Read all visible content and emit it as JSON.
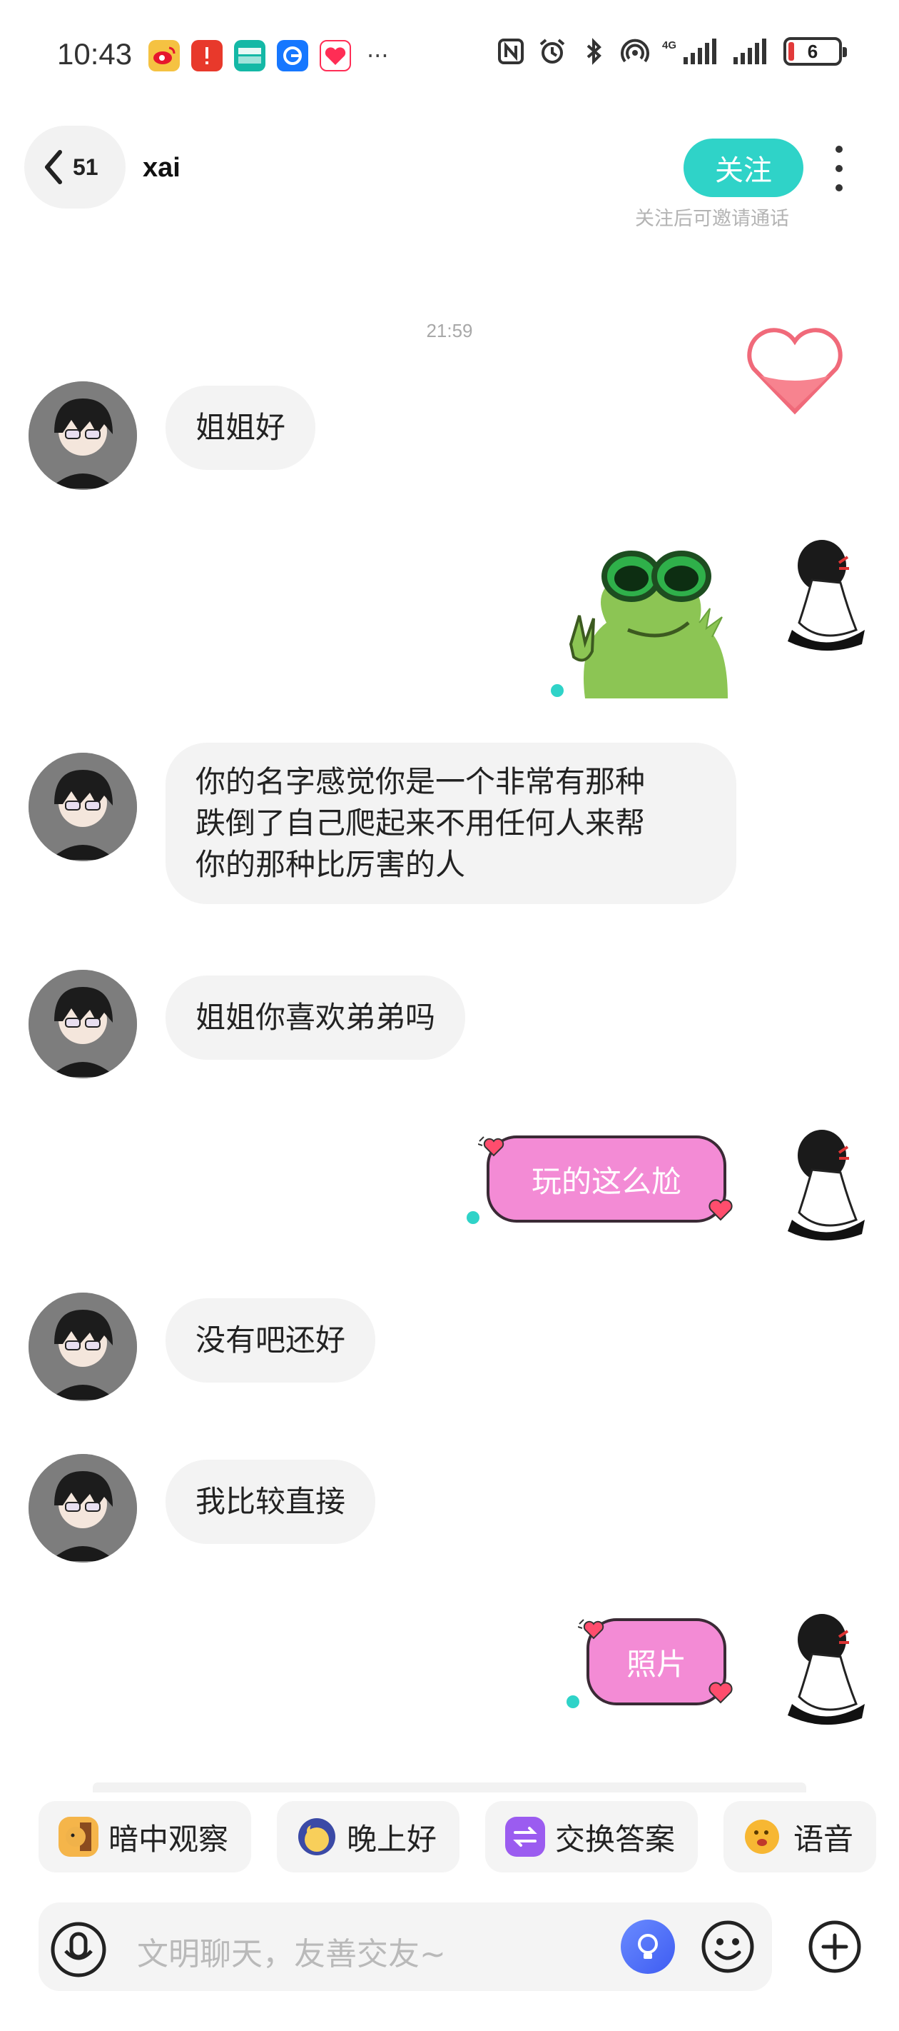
{
  "status_bar": {
    "time": "10:43",
    "more": "···",
    "battery": "6",
    "apps": [
      {
        "name": "weibo",
        "bg": "#f5c242",
        "glyph": "W"
      },
      {
        "name": "alert-app",
        "bg": "#e8392b",
        "glyph": "!"
      },
      {
        "name": "boss-zhipin",
        "bg": "#14b8a6",
        "glyph": "B"
      },
      {
        "name": "browser",
        "bg": "#1677ff",
        "glyph": "e"
      },
      {
        "name": "heart-app",
        "bg": "#ff2d55",
        "glyph": "♥"
      }
    ]
  },
  "header": {
    "unread_count": "51",
    "name": "xai",
    "follow_label": "关注",
    "follow_hint": "关注后可邀请通话"
  },
  "chat": {
    "timestamp": "21:59",
    "messages": [
      {
        "side": "left",
        "type": "text",
        "text": "姐姐好"
      },
      {
        "side": "right",
        "type": "sticker",
        "sticker": "frog-sunglasses"
      },
      {
        "side": "left",
        "type": "text",
        "lines": [
          "你的名字感觉你是一个非常有那种",
          "跌倒了自己爬起来不用任何人来帮",
          "你的那种比厉害的人"
        ]
      },
      {
        "side": "left",
        "type": "text",
        "text": "姐姐你喜欢弟弟吗"
      },
      {
        "side": "right",
        "type": "pink",
        "text": "玩的这么尬"
      },
      {
        "side": "left",
        "type": "text",
        "text": "没有吧还好"
      },
      {
        "side": "left",
        "type": "text",
        "text": "我比较直接"
      },
      {
        "side": "right",
        "type": "pink",
        "text": "照片"
      }
    ]
  },
  "quick_replies": [
    {
      "label": "暗中观察",
      "icon": "doge-peek-icon"
    },
    {
      "label": "晚上好",
      "icon": "moon-face-icon"
    },
    {
      "label": "交换答案",
      "icon": "exchange-icon"
    },
    {
      "label": "语音",
      "icon": "voice-emoji-icon"
    }
  ],
  "input": {
    "placeholder": "文明聊天，友善交友~"
  },
  "colors": {
    "accent_teal": "#2fd3c8",
    "pink_bubble": "#f38bd5",
    "left_bubble": "#f3f3f3"
  }
}
